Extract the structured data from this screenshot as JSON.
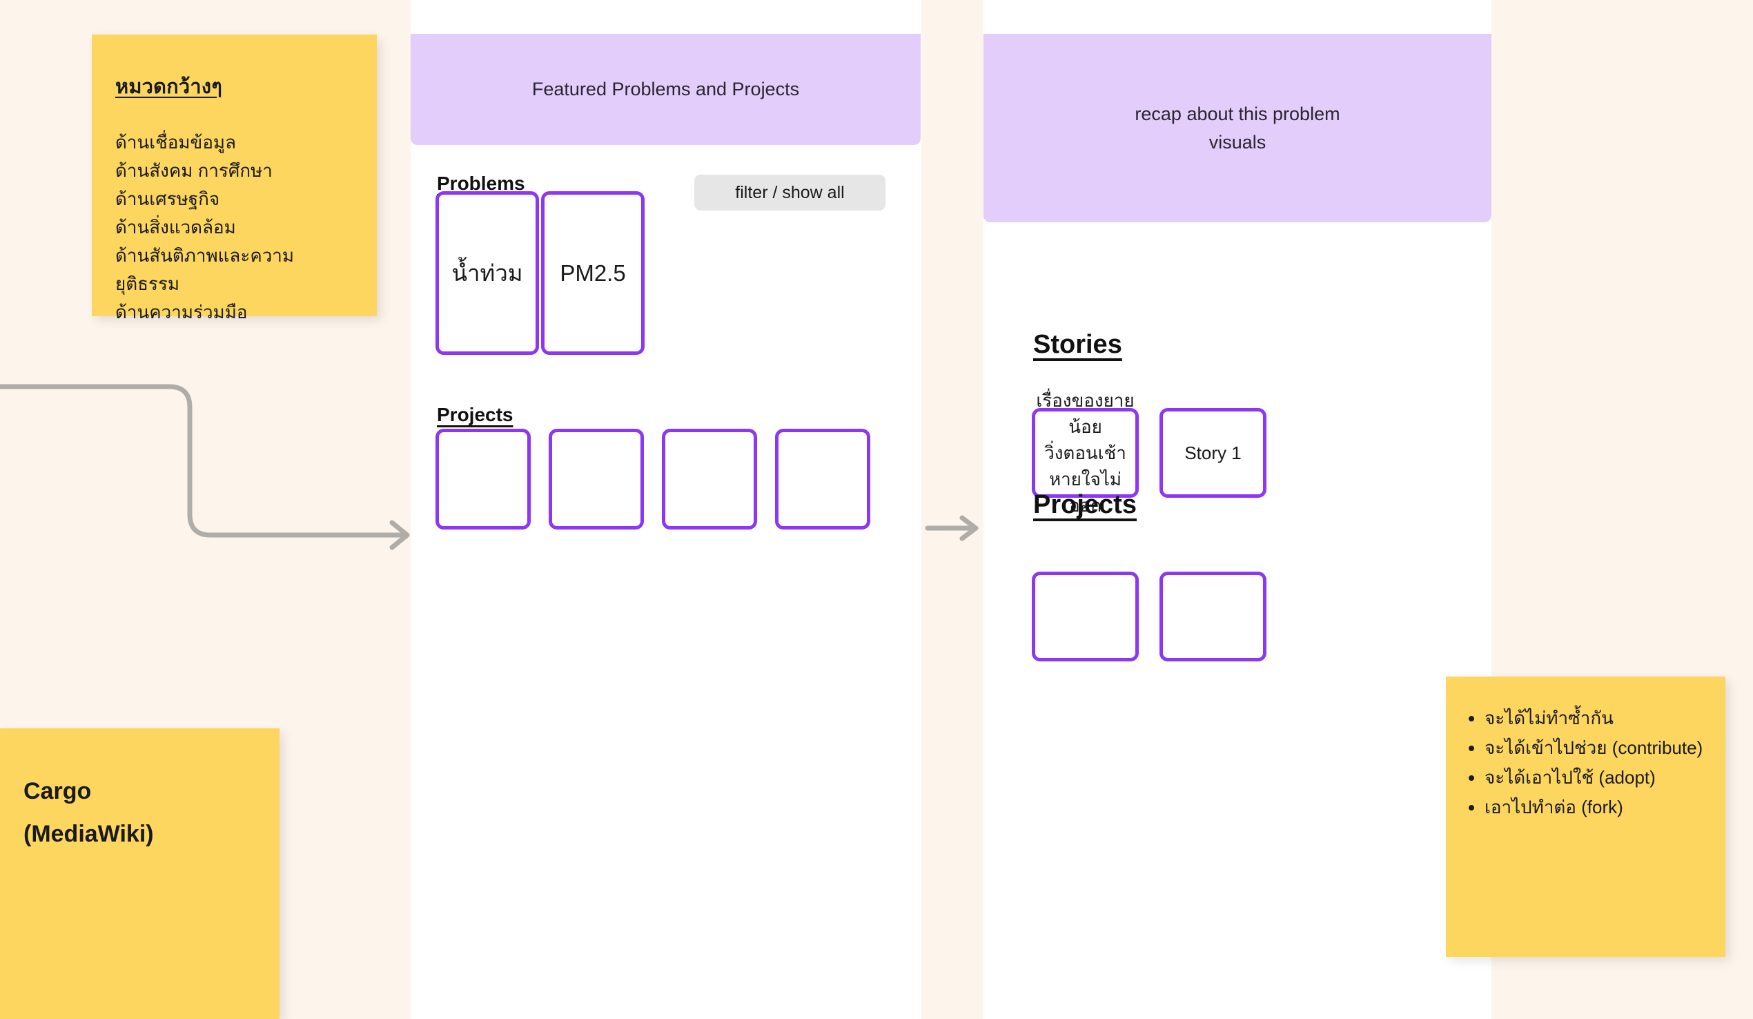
{
  "theme": {
    "background": "#FDF4EC",
    "column_bg": "#FFFFFF",
    "sticky_yellow": "#FCD65F",
    "header_purple": "#E3CDFA",
    "card_border_purple": "#8B37F5",
    "button_gray": "#E6E6E6",
    "connector_gray": "#B0ACA8",
    "text_dark": "#1A1A1A"
  },
  "categories_note": {
    "title": "หมวดกว้างๆ",
    "items": [
      "ด้านเชื่อมข้อมูล",
      "ด้านสังคม การศึกษา",
      "ด้านเศรษฐกิจ",
      "ด้านสิ่งแวดล้อม",
      "ด้านสันติภาพและความยุติธรรม",
      "ด้านความร่วมมือ"
    ]
  },
  "cargo_note": {
    "line1": "Cargo",
    "line2": "(MediaWiki)"
  },
  "benefits_note": {
    "items": [
      "จะได้ไม่ทำซ้ำกัน",
      "จะได้เข้าไปช่วย (contribute)",
      "จะได้เอาไปใช้ (adopt)",
      "เอาไปทำต่อ (fork)"
    ]
  },
  "featured_column": {
    "header": "Featured Problems and Projects",
    "problems_heading": "Problems",
    "filter_button": "filter / show all",
    "problem_cards": [
      {
        "label": "น้ำท่วม"
      },
      {
        "label": "PM2.5"
      }
    ],
    "projects_heading": "Projects",
    "project_cards": [
      {
        "label": ""
      },
      {
        "label": ""
      },
      {
        "label": ""
      },
      {
        "label": ""
      }
    ]
  },
  "detail_column": {
    "header_line1": "recap about this problem",
    "header_line2": "visuals",
    "stories_heading": "Stories",
    "story_cards": [
      {
        "line1": "เรื่องของยายน้อย",
        "line2": "วิ่งตอนเช้า",
        "line3": "หายใจไม่ออก"
      },
      {
        "line1": "Story 1",
        "line2": "",
        "line3": ""
      }
    ],
    "projects_heading": "Projects",
    "project_cards": [
      {
        "label": ""
      },
      {
        "label": ""
      }
    ]
  },
  "connectors": {
    "left_arrow_name": "flow-arrow-to-featured",
    "mid_arrow_name": "flow-arrow-to-detail"
  }
}
